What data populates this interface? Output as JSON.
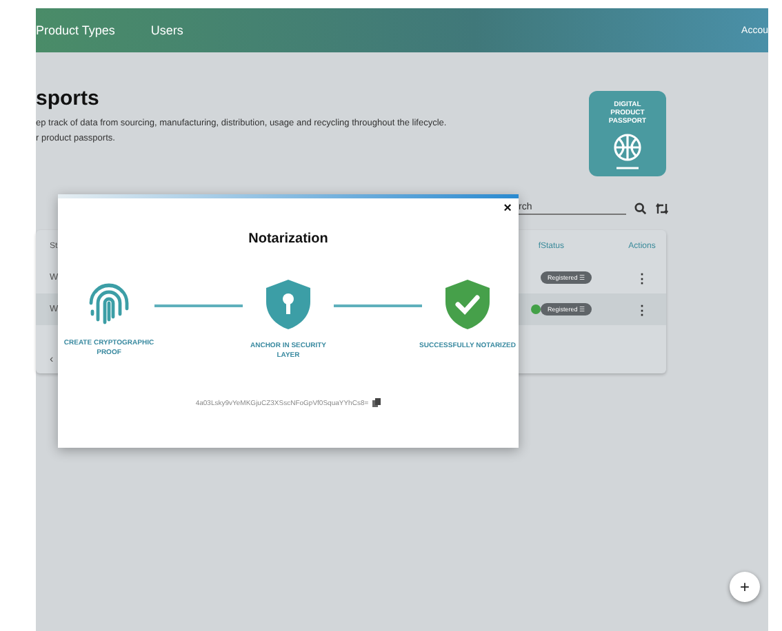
{
  "nav": {
    "items": [
      {
        "label": "Product Types"
      },
      {
        "label": "Users"
      }
    ],
    "account": "Accou"
  },
  "page": {
    "title": "sports",
    "description": [
      "ep track of data from sourcing, manufacturing, distribution, usage and recycling throughout the lifecycle.",
      "r product passports."
    ],
    "badge": {
      "lines": [
        "DIGITAL",
        "PRODUCT",
        "PASSPORT"
      ]
    }
  },
  "search": {
    "value": "rch"
  },
  "table": {
    "columns": [
      "St",
      "f",
      "Status",
      "Actions"
    ],
    "rows": [
      {
        "column_1": "W",
        "status": "Registered ☰",
        "actions": "⋮",
        "selected": false,
        "dot": false
      },
      {
        "column_1": "W",
        "status": "Registered ☰",
        "actions": "⋮",
        "selected": true,
        "dot": true
      }
    ],
    "pager": "‹"
  },
  "dialog": {
    "close": "×",
    "title": "Notarization",
    "steps": [
      {
        "kind": "fingerprint",
        "label": "CREATE CRYPTOGRAPHIC PROOF",
        "color": "#3c9ea6"
      },
      {
        "kind": "lock",
        "label": "ANCHOR IN SECURITY LAYER",
        "color": "#3c9ea6"
      },
      {
        "kind": "check",
        "label": "SUCCESSFULLY NOTARIZED",
        "color": "#46a04a"
      }
    ],
    "hash": "4a03Lsky9vYeMKGjuCZ3XSscNFoGpVf0SquaYYhCs8="
  },
  "fab": "+"
}
